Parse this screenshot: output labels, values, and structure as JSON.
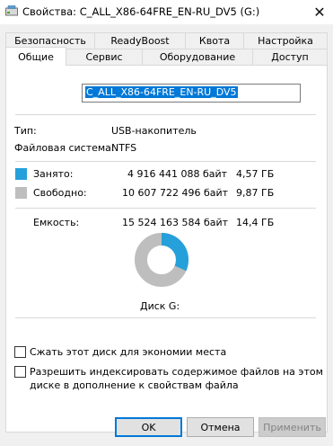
{
  "window": {
    "title": "Свойства: C_ALL_X86-64FRE_EN-RU_DV5 (G:)",
    "close_glyph": "✕"
  },
  "tabs_row1": [
    {
      "label": "Безопасность"
    },
    {
      "label": "ReadyBoost"
    },
    {
      "label": "Квота"
    },
    {
      "label": "Настройка"
    }
  ],
  "tabs_row2": [
    {
      "label": "Общие",
      "active": true
    },
    {
      "label": "Сервис"
    },
    {
      "label": "Оборудование"
    },
    {
      "label": "Доступ"
    }
  ],
  "general": {
    "volume_name": "C_ALL_X86-64FRE_EN-RU_DV5",
    "type_label": "Тип:",
    "type_value": "USB-накопитель",
    "fs_label": "Файловая система:",
    "fs_value": "NTFS",
    "used_label": "Занято:",
    "used_bytes": "4 916 441 088 байт",
    "used_size": "4,57 ГБ",
    "free_label": "Свободно:",
    "free_bytes": "10 607 722 496 байт",
    "free_size": "9,87 ГБ",
    "capacity_label": "Емкость:",
    "capacity_bytes": "15 524 163 584 байт",
    "capacity_size": "14,4 ГБ",
    "disk_label": "Диск G:",
    "used_fraction": 0.3167,
    "used_color": "#26a0da",
    "free_color": "#bebebe",
    "compress_label": "Сжать этот диск для экономии места",
    "index_label_line1": "Разрешить индексировать содержимое файлов на этом",
    "index_label_line2": "диске в дополнение к свойствам файла"
  },
  "buttons": {
    "ok": "OK",
    "cancel": "Отмена",
    "apply": "Применить"
  }
}
